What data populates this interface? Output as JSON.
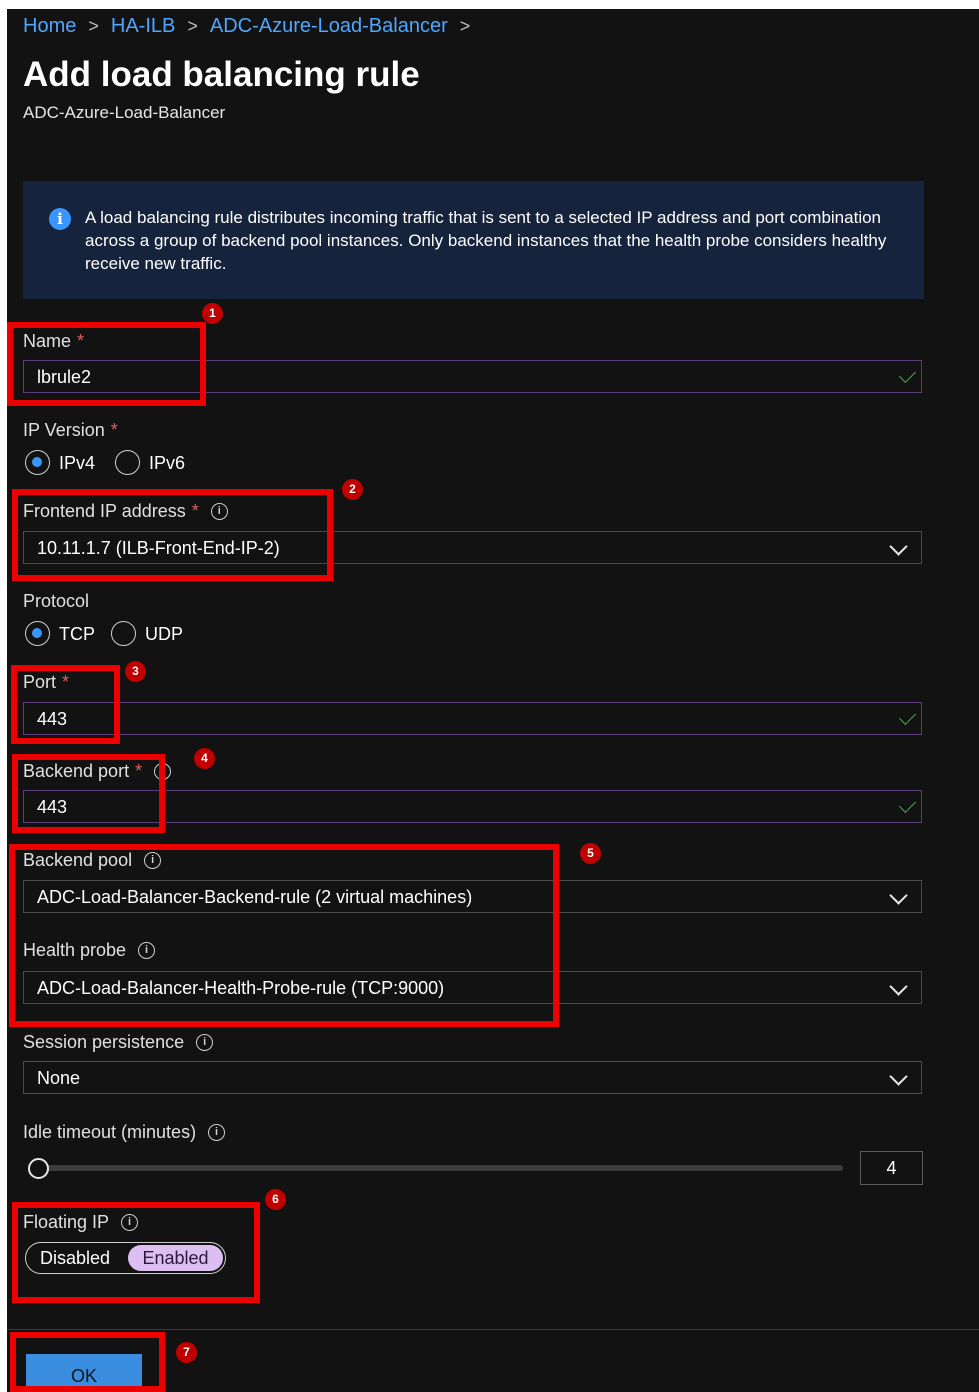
{
  "breadcrumb": [
    "Home",
    "HA-ILB",
    "ADC-Azure-Load-Balancer"
  ],
  "page": {
    "title": "Add load balancing rule",
    "subtitle": "ADC-Azure-Load-Balancer"
  },
  "info_text": "A load balancing rule distributes incoming traffic that is sent to a selected IP address and port combination across a group of backend pool instances. Only backend instances that the health probe considers healthy receive new traffic.",
  "form": {
    "name": {
      "label": "Name",
      "value": "lbrule2"
    },
    "ip_version": {
      "label": "IP Version",
      "options": [
        "IPv4",
        "IPv6"
      ],
      "selected": "IPv4"
    },
    "frontend_ip": {
      "label": "Frontend IP address",
      "value": "10.11.1.7 (ILB-Front-End-IP-2)"
    },
    "protocol": {
      "label": "Protocol",
      "options": [
        "TCP",
        "UDP"
      ],
      "selected": "TCP"
    },
    "port": {
      "label": "Port",
      "value": "443"
    },
    "backend_port": {
      "label": "Backend port",
      "value": "443"
    },
    "backend_pool": {
      "label": "Backend pool",
      "value": "ADC-Load-Balancer-Backend-rule (2 virtual machines)"
    },
    "health_probe": {
      "label": "Health probe",
      "value": "ADC-Load-Balancer-Health-Probe-rule (TCP:9000)"
    },
    "session_persistence": {
      "label": "Session persistence",
      "value": "None"
    },
    "idle_timeout": {
      "label": "Idle timeout (minutes)",
      "value": "4"
    },
    "floating_ip": {
      "label": "Floating IP",
      "options": [
        "Disabled",
        "Enabled"
      ],
      "selected": "Enabled"
    }
  },
  "badges": [
    "1",
    "2",
    "3",
    "4",
    "5",
    "6",
    "7"
  ],
  "ok_label": "OK",
  "colors": {
    "accent": "#3a96ff",
    "highlight": "#ec0000",
    "background": "#121212"
  }
}
